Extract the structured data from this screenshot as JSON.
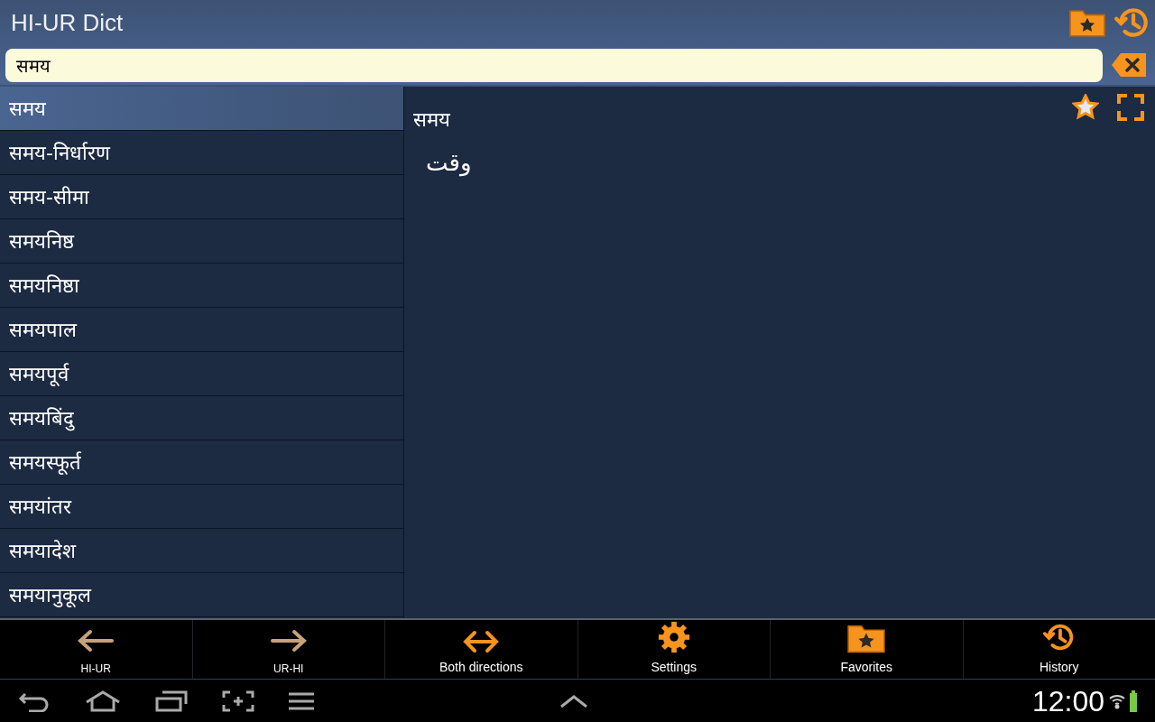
{
  "app_bar": {
    "title": "HI-UR Dict"
  },
  "search": {
    "value": "समय"
  },
  "results": [
    {
      "label": "समय",
      "selected": true
    },
    {
      "label": "समय-निर्धारण",
      "selected": false
    },
    {
      "label": "समय-सीमा",
      "selected": false
    },
    {
      "label": "समयनिष्ठ",
      "selected": false
    },
    {
      "label": "समयनिष्ठा",
      "selected": false
    },
    {
      "label": "समयपाल",
      "selected": false
    },
    {
      "label": "समयपूर्व",
      "selected": false
    },
    {
      "label": "समयबिंदु",
      "selected": false
    },
    {
      "label": "समयस्फूर्त",
      "selected": false
    },
    {
      "label": "समयांतर",
      "selected": false
    },
    {
      "label": "समयादेश",
      "selected": false
    },
    {
      "label": "समयानुकूल",
      "selected": false
    }
  ],
  "entry": {
    "headword": "समय",
    "translation": "وقت"
  },
  "toolbar": [
    {
      "kind": "left",
      "label": "HI-UR",
      "selected": false
    },
    {
      "kind": "right",
      "label": "UR-HI",
      "selected": false
    },
    {
      "kind": "both",
      "label": "Both directions",
      "selected": true
    },
    {
      "kind": "settings",
      "label": "Settings"
    },
    {
      "kind": "favorites",
      "label": "Favorites"
    },
    {
      "kind": "history",
      "label": "History"
    }
  ],
  "system_bar": {
    "time": "12:00"
  }
}
